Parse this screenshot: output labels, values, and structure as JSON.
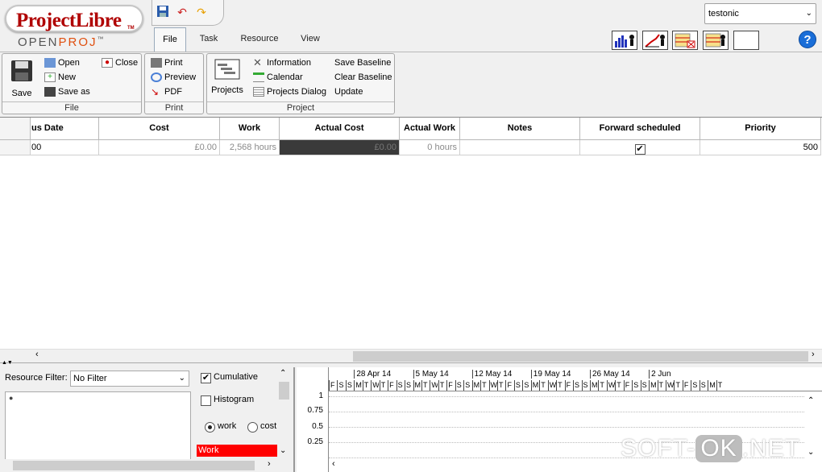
{
  "logo": {
    "name": "ProjectLibre",
    "tm": "TM",
    "sub_open": "OPEN",
    "sub_proj": "PROJ",
    "sub_tm": "™"
  },
  "tabs": [
    "File",
    "Task",
    "Resource",
    "View"
  ],
  "project_select": {
    "value": "testonic"
  },
  "ribbon": {
    "file": {
      "label": "File",
      "save": "Save",
      "open": "Open",
      "new": "New",
      "save_as": "Save as",
      "close": "Close"
    },
    "print": {
      "label": "Print",
      "print": "Print",
      "preview": "Preview",
      "pdf": "PDF"
    },
    "project": {
      "label": "Project",
      "projects": "Projects",
      "information": "Information",
      "calendar": "Calendar",
      "projects_dialog": "Projects Dialog",
      "save_baseline": "Save Baseline",
      "clear_baseline": "Clear Baseline",
      "update": "Update"
    }
  },
  "table": {
    "headers": [
      "us Date",
      "Cost",
      "Work",
      "Actual Cost",
      "Actual Work",
      "Notes",
      "Forward scheduled",
      "Priority"
    ],
    "row": [
      "00",
      "£0.00",
      "2,568 hours",
      "£0.00",
      "0 hours",
      "",
      "✔",
      "500"
    ]
  },
  "bottom_left": {
    "filter_label": "Resource Filter:",
    "filter_value": "No Filter",
    "cumulative": "Cumulative",
    "histogram": "Histogram",
    "work": "work",
    "cost": "cost",
    "work_bar": "Work"
  },
  "chart": {
    "weeks": [
      "28 Apr 14",
      "5 May 14",
      "12 May 14",
      "19 May 14",
      "26 May 14",
      "2 Jun"
    ],
    "days": [
      "F",
      "S",
      "S",
      "M",
      "T",
      "W",
      "T",
      "F",
      "S",
      "S",
      "M",
      "T",
      "W",
      "T",
      "F",
      "S",
      "S",
      "M",
      "T",
      "W",
      "T",
      "F",
      "S",
      "S",
      "M",
      "T",
      "W",
      "T",
      "F",
      "S",
      "S",
      "M",
      "T",
      "W",
      "T",
      "F",
      "S",
      "S",
      "M",
      "T",
      "W",
      "T",
      "F",
      "S",
      "S",
      "M",
      "T"
    ],
    "yticks": [
      "1",
      "0.75",
      "0.5",
      "0.25"
    ]
  },
  "watermark": {
    "a": "SOFT-",
    "b": "OK",
    "c": ".NET"
  },
  "colors": {
    "accent": "#b00000",
    "work_bar": "#ff0000",
    "help": "#1a6ed8"
  }
}
